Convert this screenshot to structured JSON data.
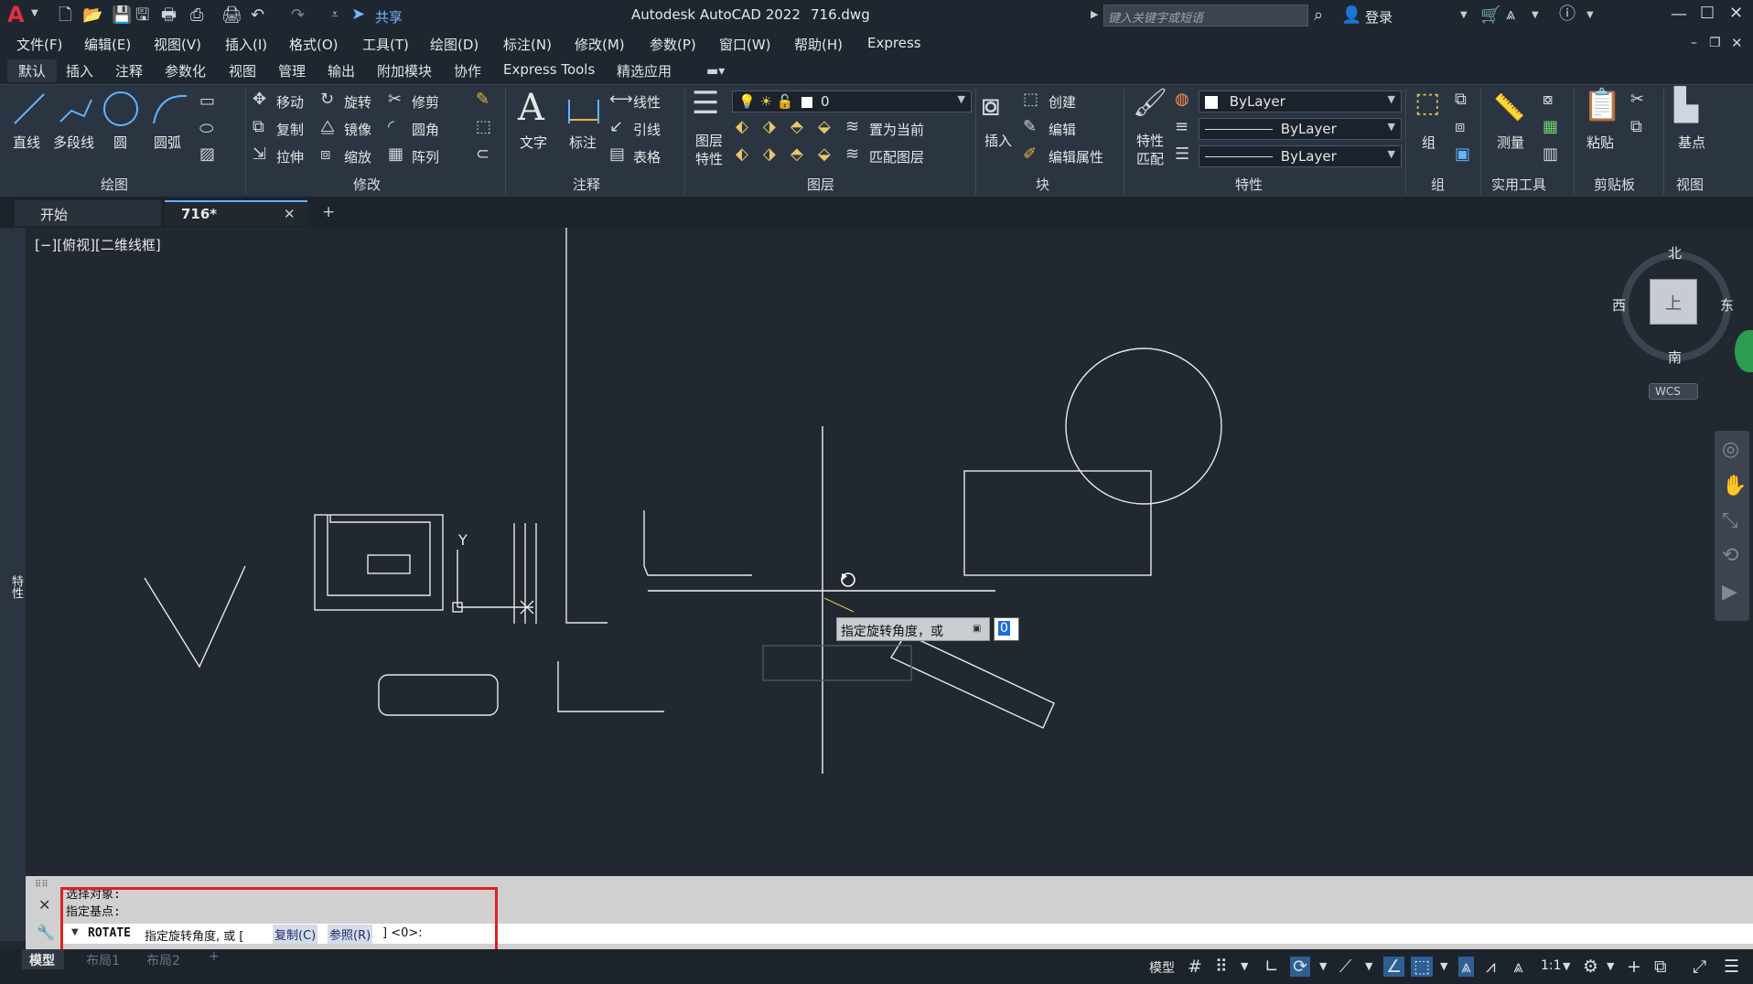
{
  "titlebar": {
    "app_title": "Autodesk AutoCAD 2022",
    "file_name": "716.dwg",
    "share_label": "共享",
    "search_placeholder": "键入关键字或短语",
    "login_label": "登录"
  },
  "menu": {
    "items": [
      "文件(F)",
      "编辑(E)",
      "视图(V)",
      "插入(I)",
      "格式(O)",
      "工具(T)",
      "绘图(D)",
      "标注(N)",
      "修改(M)",
      "参数(P)",
      "窗口(W)",
      "帮助(H)",
      "Express"
    ]
  },
  "ribbon_tabs": {
    "items": [
      "默认",
      "插入",
      "注释",
      "参数化",
      "视图",
      "管理",
      "输出",
      "附加模块",
      "协作",
      "Express Tools",
      "精选应用"
    ],
    "active": "默认"
  },
  "ribbon": {
    "draw": {
      "label": "绘图",
      "line": "直线",
      "polyline": "多段线",
      "circle": "圆",
      "arc": "圆弧"
    },
    "modify": {
      "label": "修改",
      "move": "移动",
      "rotate": "旋转",
      "trim": "修剪",
      "copy": "复制",
      "mirror": "镜像",
      "fillet": "圆角",
      "stretch": "拉伸",
      "scale": "缩放",
      "array": "阵列"
    },
    "annotation": {
      "label": "注释",
      "text": "文字",
      "dimension": "标注",
      "linear": "线性",
      "leader": "引线",
      "table": "表格"
    },
    "layers": {
      "label": "图层",
      "layer_props_1": "图层",
      "layer_props_2": "特性",
      "current_layer": "0",
      "set_current": "置为当前",
      "match_layer": "匹配图层"
    },
    "block": {
      "label": "块",
      "insert": "插入",
      "create": "创建",
      "edit": "编辑",
      "edit_attr": "编辑属性"
    },
    "properties": {
      "label": "特性",
      "match_1": "特性",
      "match_2": "匹配",
      "color": "ByLayer",
      "linetype": "ByLayer",
      "lineweight": "ByLayer"
    },
    "group": {
      "label": "组",
      "group": "组"
    },
    "utilities": {
      "label": "实用工具",
      "measure": "测量"
    },
    "clipboard": {
      "label": "剪贴板",
      "paste": "粘贴"
    },
    "view": {
      "label": "视图",
      "base": "基点"
    }
  },
  "doc_tabs": {
    "start": "开始",
    "active": "716*"
  },
  "viewport": {
    "label": "[−][俯视][二维线框]",
    "compass": {
      "north": "北",
      "south": "南",
      "east": "东",
      "west": "西",
      "top": "上"
    },
    "wcs": "WCS",
    "side_label": "特性",
    "axis_y": "Y"
  },
  "tooltip": {
    "prompt": "指定旋转角度，或",
    "value": "0"
  },
  "command": {
    "history_1": "选择对象:",
    "history_2": "指定基点:",
    "cmd_name": "ROTATE",
    "cmd_prompt": "指定旋转角度, 或 [",
    "opt_copy": "复制(C)",
    "opt_ref": "参照(R)",
    "cmd_tail": "] <0>:"
  },
  "status": {
    "model_tab": "模型",
    "layout1": "布局1",
    "layout2": "布局2",
    "model_label": "模型",
    "scale": "1:1"
  }
}
